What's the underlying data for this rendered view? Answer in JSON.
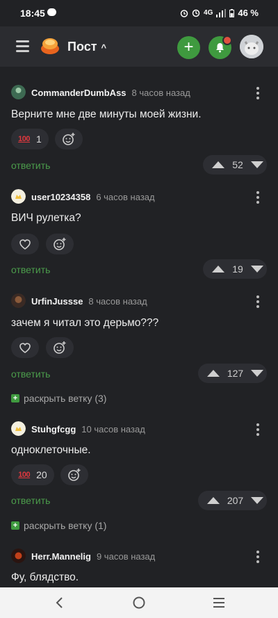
{
  "status_bar": {
    "time": "18:45",
    "network": "4G",
    "battery": "46 %"
  },
  "header": {
    "title": "Пост"
  },
  "comments": [
    {
      "user": "CommanderDumbAss",
      "time": "8 часов назад",
      "text": "Верните мне две минуты моей жизни.",
      "reaction_icon": "hundred-points",
      "reaction_count": "1",
      "reply_label": "ответить",
      "rating": "52"
    },
    {
      "user": "user10234358",
      "time": "6 часов назад",
      "text": "ВИЧ рулетка?",
      "reaction_icon": "heart",
      "reply_label": "ответить",
      "rating": "19"
    },
    {
      "user": "UrfinJussse",
      "time": "8 часов назад",
      "text": "зачем я читал это дерьмо???",
      "reaction_icon": "heart",
      "reply_label": "ответить",
      "rating": "127",
      "expand_label": "раскрыть ветку (3)"
    },
    {
      "user": "Stuhgfcgg",
      "time": "10 часов назад",
      "text": "одноклеточные.",
      "reaction_icon": "hundred-points",
      "reaction_count": "20",
      "reply_label": "ответить",
      "rating": "207",
      "expand_label": "раскрыть ветку (1)"
    },
    {
      "user": "Herr.Mannelig",
      "time": "9 часов назад",
      "text": "Фу, блядство."
    }
  ],
  "colors": {
    "background": "#212225",
    "accent_green": "#3f9a3f",
    "link_green": "#4b9c4b",
    "notification_red": "#e0503f",
    "hundred_red": "#e0383e"
  }
}
